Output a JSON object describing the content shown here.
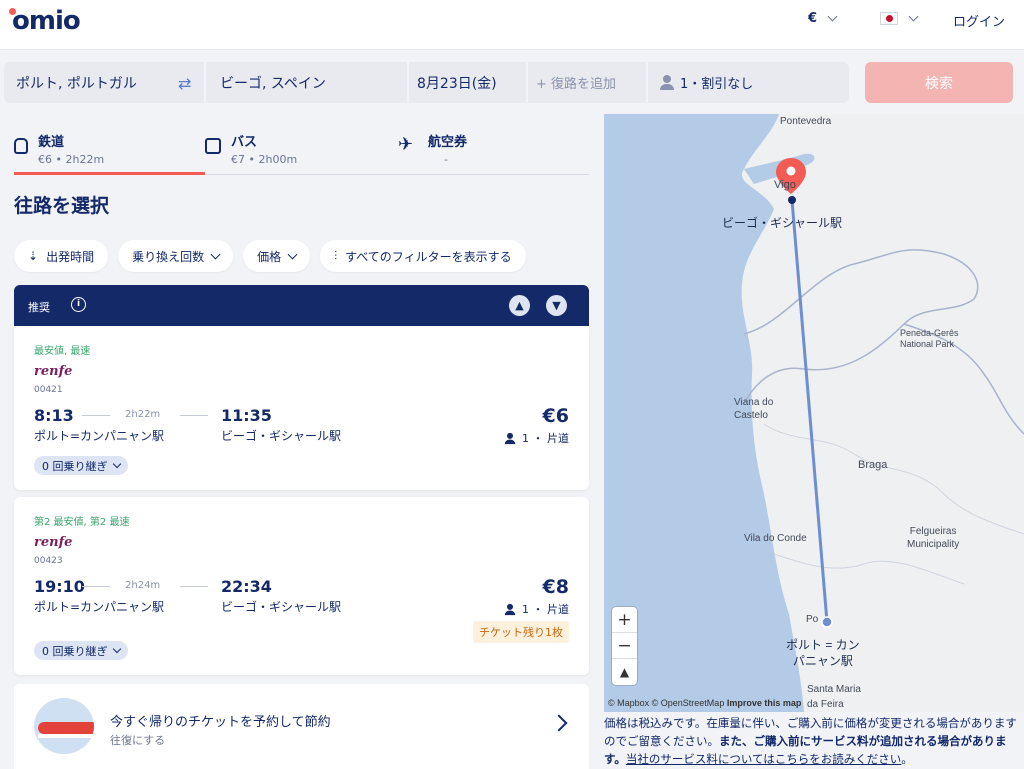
{
  "header": {
    "logo": "omio",
    "currency": "€",
    "login": "ログイン"
  },
  "search": {
    "from": "ポルト, ポルトガル",
    "to": "ビーゴ, スペイン",
    "date": "8月23日(金)",
    "return_placeholder": "+ 復路を追加",
    "passengers": "1・割引なし",
    "search_button": "検索"
  },
  "tabs": [
    {
      "title": "鉄道",
      "sub": "€6 • 2h22m",
      "icon": "train-icon"
    },
    {
      "title": "バス",
      "sub": "€7 • 2h00m",
      "icon": "bus-icon"
    },
    {
      "title": "航空券",
      "sub": "-",
      "icon": "plane-icon"
    }
  ],
  "section_title": "往路を選択",
  "filters": [
    "出発時間",
    "乗り換え回数",
    "価格",
    "すべてのフィルターを表示する"
  ],
  "recommended": {
    "label": "推奨"
  },
  "results": [
    {
      "tagline": "最安値, 最速",
      "carrier": "renfe",
      "train_no": "00421",
      "dep_time": "8:13",
      "arr_time": "11:35",
      "duration": "2h22m",
      "dep_station": "ポルト=カンパニャン駅",
      "arr_station": "ビーゴ・ギシャール駅",
      "price": "€6",
      "pax": "1 ・ 片道",
      "transfers": "0 回乗り継ぎ"
    },
    {
      "tagline": "第2 最安値, 第2 最速",
      "carrier": "renfe",
      "train_no": "00423",
      "dep_time": "19:10",
      "arr_time": "22:34",
      "duration": "2h24m",
      "dep_station": "ポルト=カンパニャン駅",
      "arr_station": "ビーゴ・ギシャール駅",
      "price": "€8",
      "pax": "1 ・ 片道",
      "seats_left": "チケット残り1枚",
      "transfers": "0 回乗り継ぎ"
    }
  ],
  "promo": {
    "title": "今すぐ帰りのチケットを予約して節約",
    "sub": "往復にする"
  },
  "map": {
    "labels": {
      "pontevedra": "Pontevedra",
      "vigo": "Vigo",
      "vigo_station": "ビーゴ・ギシャール駅",
      "peneda": "Peneda-Gerês\nNational Park",
      "viana": "Viana do\nCastelo",
      "braga": "Braga",
      "felgueiras": "Felgueiras\nMunicipality",
      "vila_conde": "Vila do Conde",
      "po": "Po",
      "porto_station": "ポルト = カン\nパニャン駅",
      "santa_maria": "Santa Maria",
      "feira": "da Feira"
    },
    "zoom_in": "+",
    "zoom_out": "−",
    "compass": "▲",
    "attribution": "© Mapbox © OpenStreetMap",
    "improve": "Improve this map"
  },
  "disclaimer": {
    "part1": "価格は税込みです。在庫量に伴い、ご購入前に価格が変更される場合がありますのでご留意ください。",
    "part2": "また、ご購入前にサービス料が追加される場合があります。",
    "link": "当社のサービス料についてはこちらをお読みください",
    "end": "。"
  }
}
